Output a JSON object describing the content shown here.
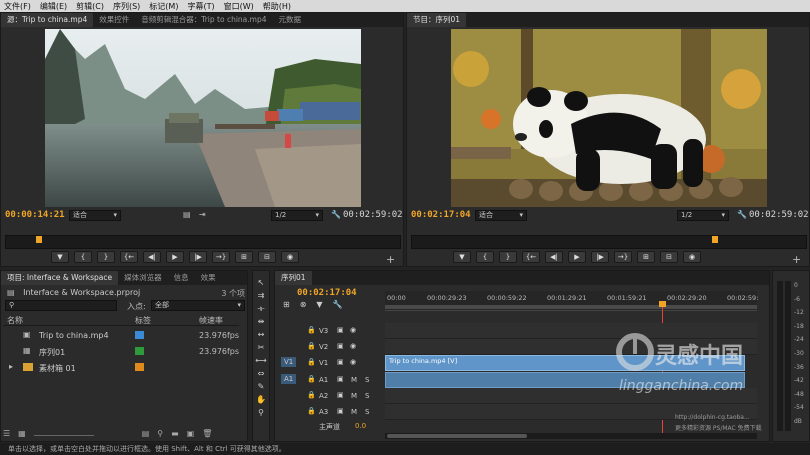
{
  "menu": [
    "文件(F)",
    "编辑(E)",
    "剪辑(C)",
    "序列(S)",
    "标记(M)",
    "字幕(T)",
    "窗口(W)",
    "帮助(H)"
  ],
  "source_monitor": {
    "tabs": [
      "源：Trip to china.mp4",
      "效果控件",
      "音频剪辑混合器：Trip to china.mp4",
      "元数据"
    ],
    "timecode_in": "00:00:14:21",
    "fit": "适合",
    "resolution": "1/2",
    "timecode_dur": "00:02:59:02"
  },
  "program_monitor": {
    "tabs": [
      "节目：序列01"
    ],
    "timecode_in": "00:02:17:04",
    "fit": "适合",
    "resolution": "1/2",
    "timecode_dur": "00:02:59:02"
  },
  "project": {
    "tabs": [
      "项目: Interface & Workspace",
      "媒体浏览器",
      "信息",
      "效果"
    ],
    "file": "Interface & Workspace.prproj",
    "count": "3 个项",
    "in_label": "入点:",
    "in_value": "全部",
    "col_name": "名称",
    "col_label": "标签",
    "col_fps": "帧速率",
    "items": [
      {
        "name": "Trip to china.mp4",
        "fps": "23.976fps",
        "color": "#3a8ad6"
      },
      {
        "name": "序列01",
        "fps": "23.976fps",
        "color": "#2f9a3c"
      },
      {
        "name": "素材箱 01",
        "fps": "",
        "color": "#e08a1e"
      }
    ]
  },
  "timeline": {
    "tab": "序列01",
    "timecode": "00:02:17:04",
    "ruler": [
      "00:00",
      "00:00:29:23",
      "00:00:59:22",
      "00:01:29:21",
      "00:01:59:21",
      "00:02:29:20",
      "00:02:59:"
    ],
    "video_tracks": [
      "V3",
      "V2",
      "V1"
    ],
    "audio_tracks": [
      "A1",
      "A2",
      "A3"
    ],
    "master": "主声道",
    "master_val": "0.0",
    "clip_label": "Trip to china.mp4 [V]",
    "src_v": "V1",
    "src_a": "A1",
    "m": "M",
    "s": "S"
  },
  "meter": {
    "labels": [
      "0",
      "-6",
      "-12",
      "-18",
      "-24",
      "-30",
      "-36",
      "-42",
      "-48",
      "-54",
      "dB"
    ]
  },
  "status": "单击以选择，或单击空白处并拖动以进行框选。使用 Shift、Alt 和 Ctrl 可获得其他选项。",
  "watermark": {
    "brand": "灵感中国",
    "site": "lingganchina.com",
    "sub": "http://dolphin-cg.taoba...",
    "sub2": "更多精彩资源 PS/MAC 免费下载"
  }
}
